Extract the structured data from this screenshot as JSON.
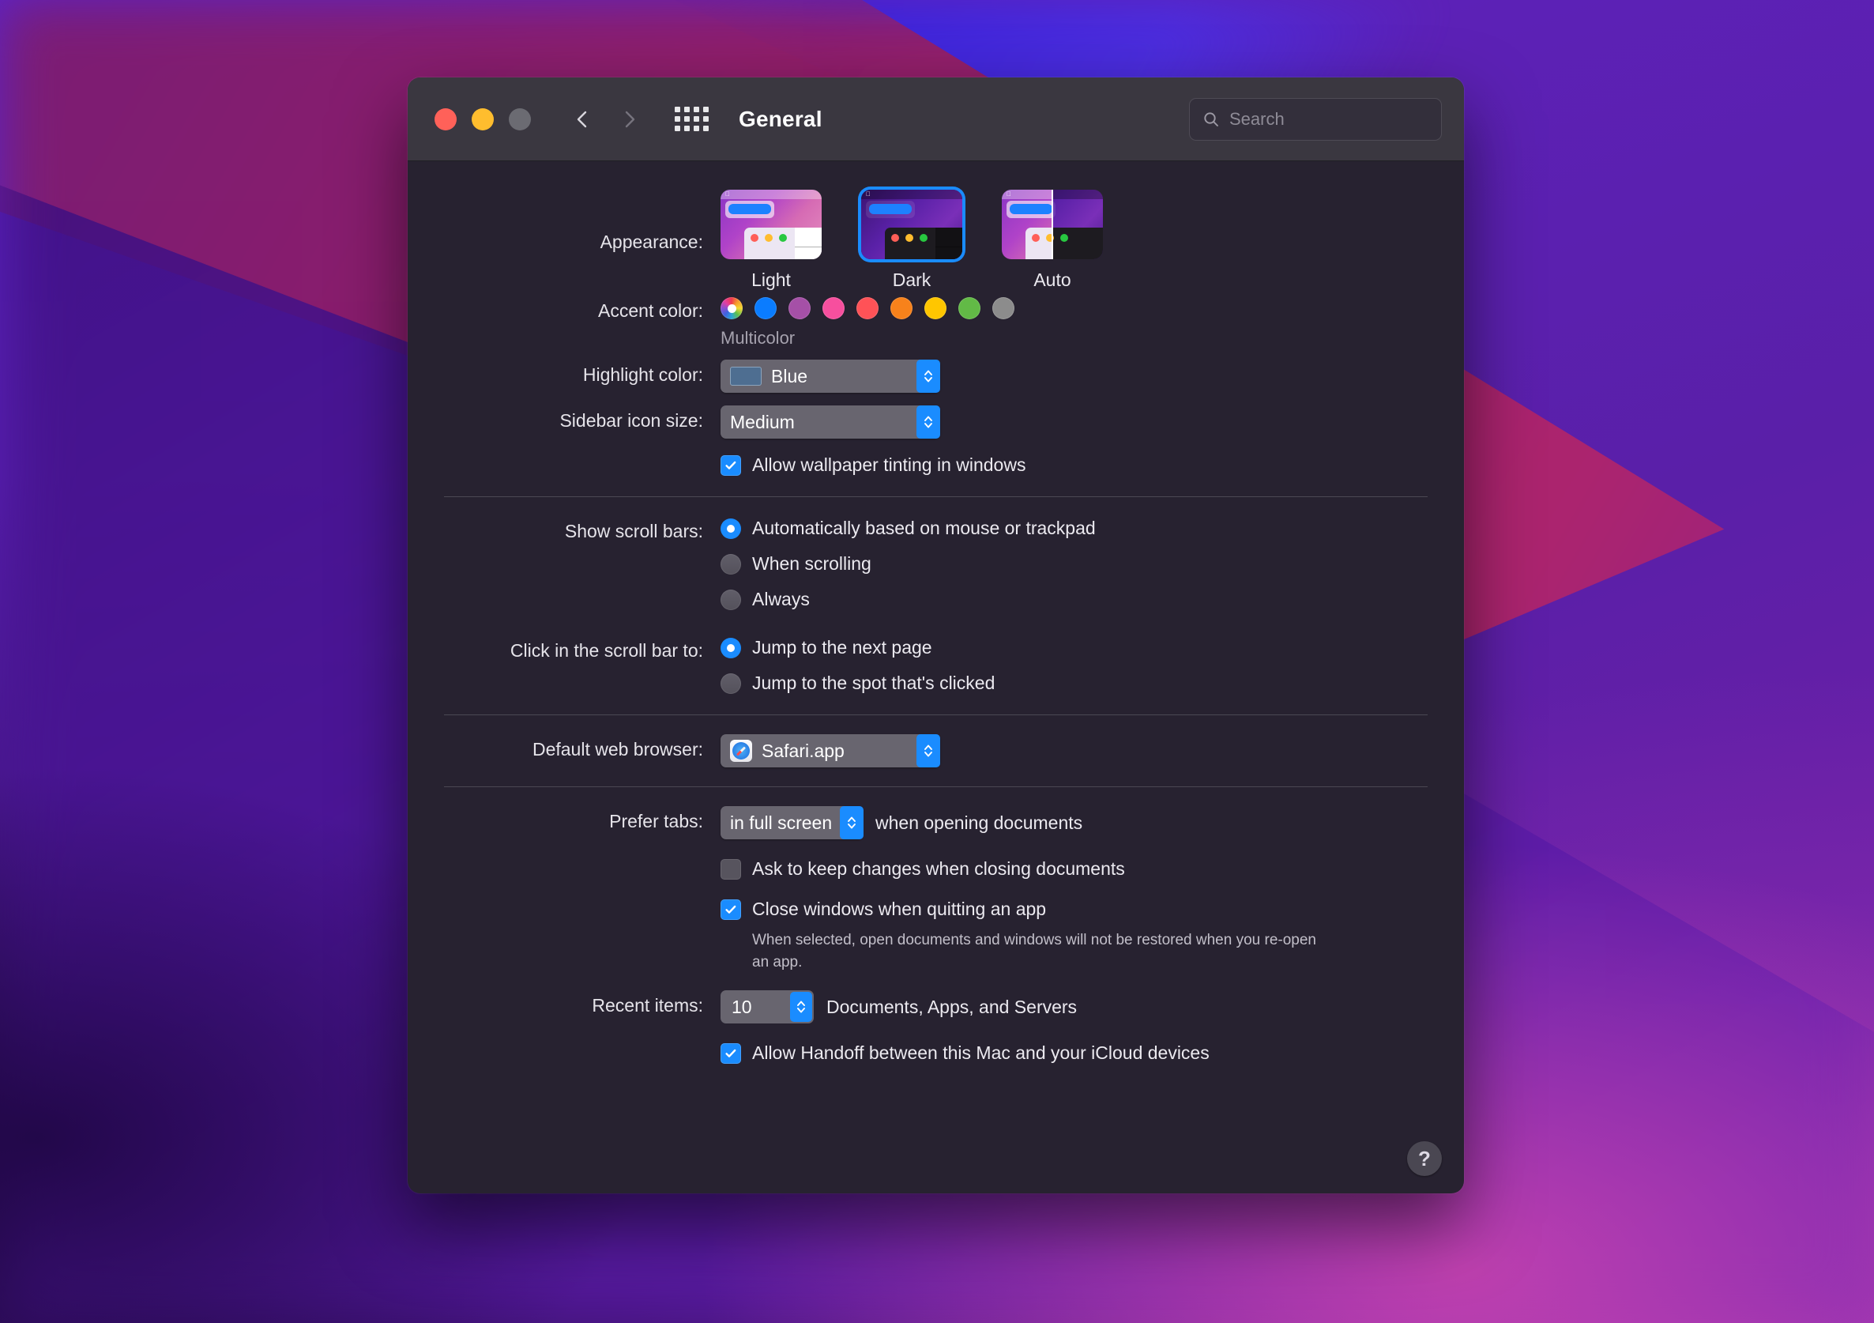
{
  "window": {
    "title": "General",
    "traffic_lights": {
      "close": "close-button",
      "minimize": "minimize-button",
      "zoom": "zoom-button"
    },
    "nav": {
      "back": "back-button",
      "forward": "forward-button",
      "grid": "show-all-button"
    }
  },
  "search": {
    "placeholder": "Search",
    "value": ""
  },
  "appearance": {
    "label": "Appearance:",
    "options": [
      {
        "id": "light",
        "label": "Light",
        "selected": false
      },
      {
        "id": "dark",
        "label": "Dark",
        "selected": true
      },
      {
        "id": "auto",
        "label": "Auto",
        "selected": false
      }
    ]
  },
  "accent_color": {
    "label": "Accent color:",
    "selected_name": "Multicolor",
    "swatches": [
      {
        "name": "multicolor",
        "hex": "multicolor",
        "selected": true
      },
      {
        "name": "blue",
        "hex": "#0a7cff",
        "selected": false
      },
      {
        "name": "purple",
        "hex": "#a550a7",
        "selected": false
      },
      {
        "name": "pink",
        "hex": "#f74f9e",
        "selected": false
      },
      {
        "name": "red",
        "hex": "#ff5257",
        "selected": false
      },
      {
        "name": "orange",
        "hex": "#f7821b",
        "selected": false
      },
      {
        "name": "yellow",
        "hex": "#ffc600",
        "selected": false
      },
      {
        "name": "green",
        "hex": "#62ba46",
        "selected": false
      },
      {
        "name": "graphite",
        "hex": "#8c8c8c",
        "selected": false
      }
    ]
  },
  "highlight_color": {
    "label": "Highlight color:",
    "value": "Blue",
    "chip_hex": "#4e6e91"
  },
  "sidebar_icon_size": {
    "label": "Sidebar icon size:",
    "value": "Medium"
  },
  "wallpaper_tinting": {
    "label": "Allow wallpaper tinting in windows",
    "checked": true
  },
  "show_scroll_bars": {
    "label": "Show scroll bars:",
    "options": [
      {
        "label": "Automatically based on mouse or trackpad",
        "selected": true
      },
      {
        "label": "When scrolling",
        "selected": false
      },
      {
        "label": "Always",
        "selected": false
      }
    ]
  },
  "click_scroll_bar": {
    "label": "Click in the scroll bar to:",
    "options": [
      {
        "label": "Jump to the next page",
        "selected": true
      },
      {
        "label": "Jump to the spot that's clicked",
        "selected": false
      }
    ]
  },
  "default_web_browser": {
    "label": "Default web browser:",
    "value": "Safari.app"
  },
  "prefer_tabs": {
    "label": "Prefer tabs:",
    "value": "in full screen",
    "suffix": "when opening documents"
  },
  "ask_keep_changes": {
    "label": "Ask to keep changes when closing documents",
    "checked": false
  },
  "close_windows": {
    "label": "Close windows when quitting an app",
    "checked": true,
    "note": "When selected, open documents and windows will not be restored when you re-open an app."
  },
  "recent_items": {
    "label": "Recent items:",
    "value": "10",
    "suffix": "Documents, Apps, and Servers"
  },
  "handoff": {
    "label": "Allow Handoff between this Mac and your iCloud devices",
    "checked": true
  },
  "help": {
    "label": "?"
  }
}
